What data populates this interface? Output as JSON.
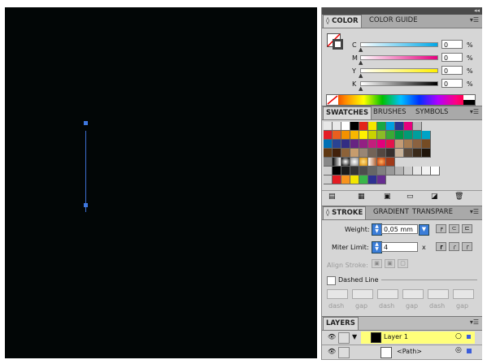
{
  "color_panel": {
    "tabs": [
      "COLOR",
      "COLOR GUIDE"
    ],
    "sliders": [
      {
        "letter": "C",
        "value": "0",
        "unit": "%"
      },
      {
        "letter": "M",
        "value": "0",
        "unit": "%"
      },
      {
        "letter": "Y",
        "value": "0",
        "unit": "%"
      },
      {
        "letter": "K",
        "value": "0",
        "unit": "%"
      }
    ]
  },
  "swatches_panel": {
    "tabs": [
      "SWATCHES",
      "BRUSHES",
      "SYMBOLS"
    ],
    "row1": [
      "#e8e8e8",
      "#e9e9e9",
      "#ffffff",
      "#000000",
      "#e32319",
      "#f4e600",
      "#18a843",
      "#00a0df",
      "#2a3590",
      "#e6007e",
      "#b8b8b8"
    ],
    "row2": [
      "#e41e26",
      "#e95f1e",
      "#f29100",
      "#f8b700",
      "#fff100",
      "#c9d200",
      "#8cbb26",
      "#3aa935",
      "#009846",
      "#009a76",
      "#009f9d",
      "#00a3c6"
    ],
    "row3": [
      "#0070b5",
      "#2a4393",
      "#322d83",
      "#662482",
      "#932083",
      "#c31e7c",
      "#e3007b",
      "#e4144b",
      "#c39b75",
      "#a67c52",
      "#8b6240",
      "#754c24"
    ],
    "row4": [
      "#603913",
      "#42210b",
      "#8c6239",
      "#c69c6d",
      "#998675",
      "#736357",
      "#534741",
      "#362f2d",
      "#c7b299",
      "#5b4a3a",
      "#3a2a1a",
      "#20150a"
    ],
    "row6": [
      "#000000",
      "#1a1a1a",
      "#333333",
      "#4d4d4d",
      "#666666",
      "#808080",
      "#999999",
      "#b3b3b3",
      "#cccccc",
      "#e6e6e6",
      "#f2f2f2",
      "#ffffff"
    ],
    "row7": [
      "#e31c23",
      "#f7931e",
      "#f2e600",
      "#39b54a",
      "#2e3192",
      "#662d91"
    ]
  },
  "stroke_panel": {
    "tabs": [
      "STROKE",
      "GRADIENT",
      "TRANSPARE"
    ],
    "weight_label": "Weight:",
    "weight_value": "0,05 mm",
    "miter_label": "Miter Limit:",
    "miter_value": "4",
    "miter_unit": "x",
    "align_label": "Align Stroke:",
    "dashed_label": "Dashed Line",
    "dash_labels": [
      "dash",
      "gap",
      "dash",
      "gap",
      "dash",
      "gap"
    ]
  },
  "layers_panel": {
    "title": "LAYERS",
    "layer_name": "Layer 1",
    "path_name": "<Path>",
    "accent": "#ffff7a"
  }
}
